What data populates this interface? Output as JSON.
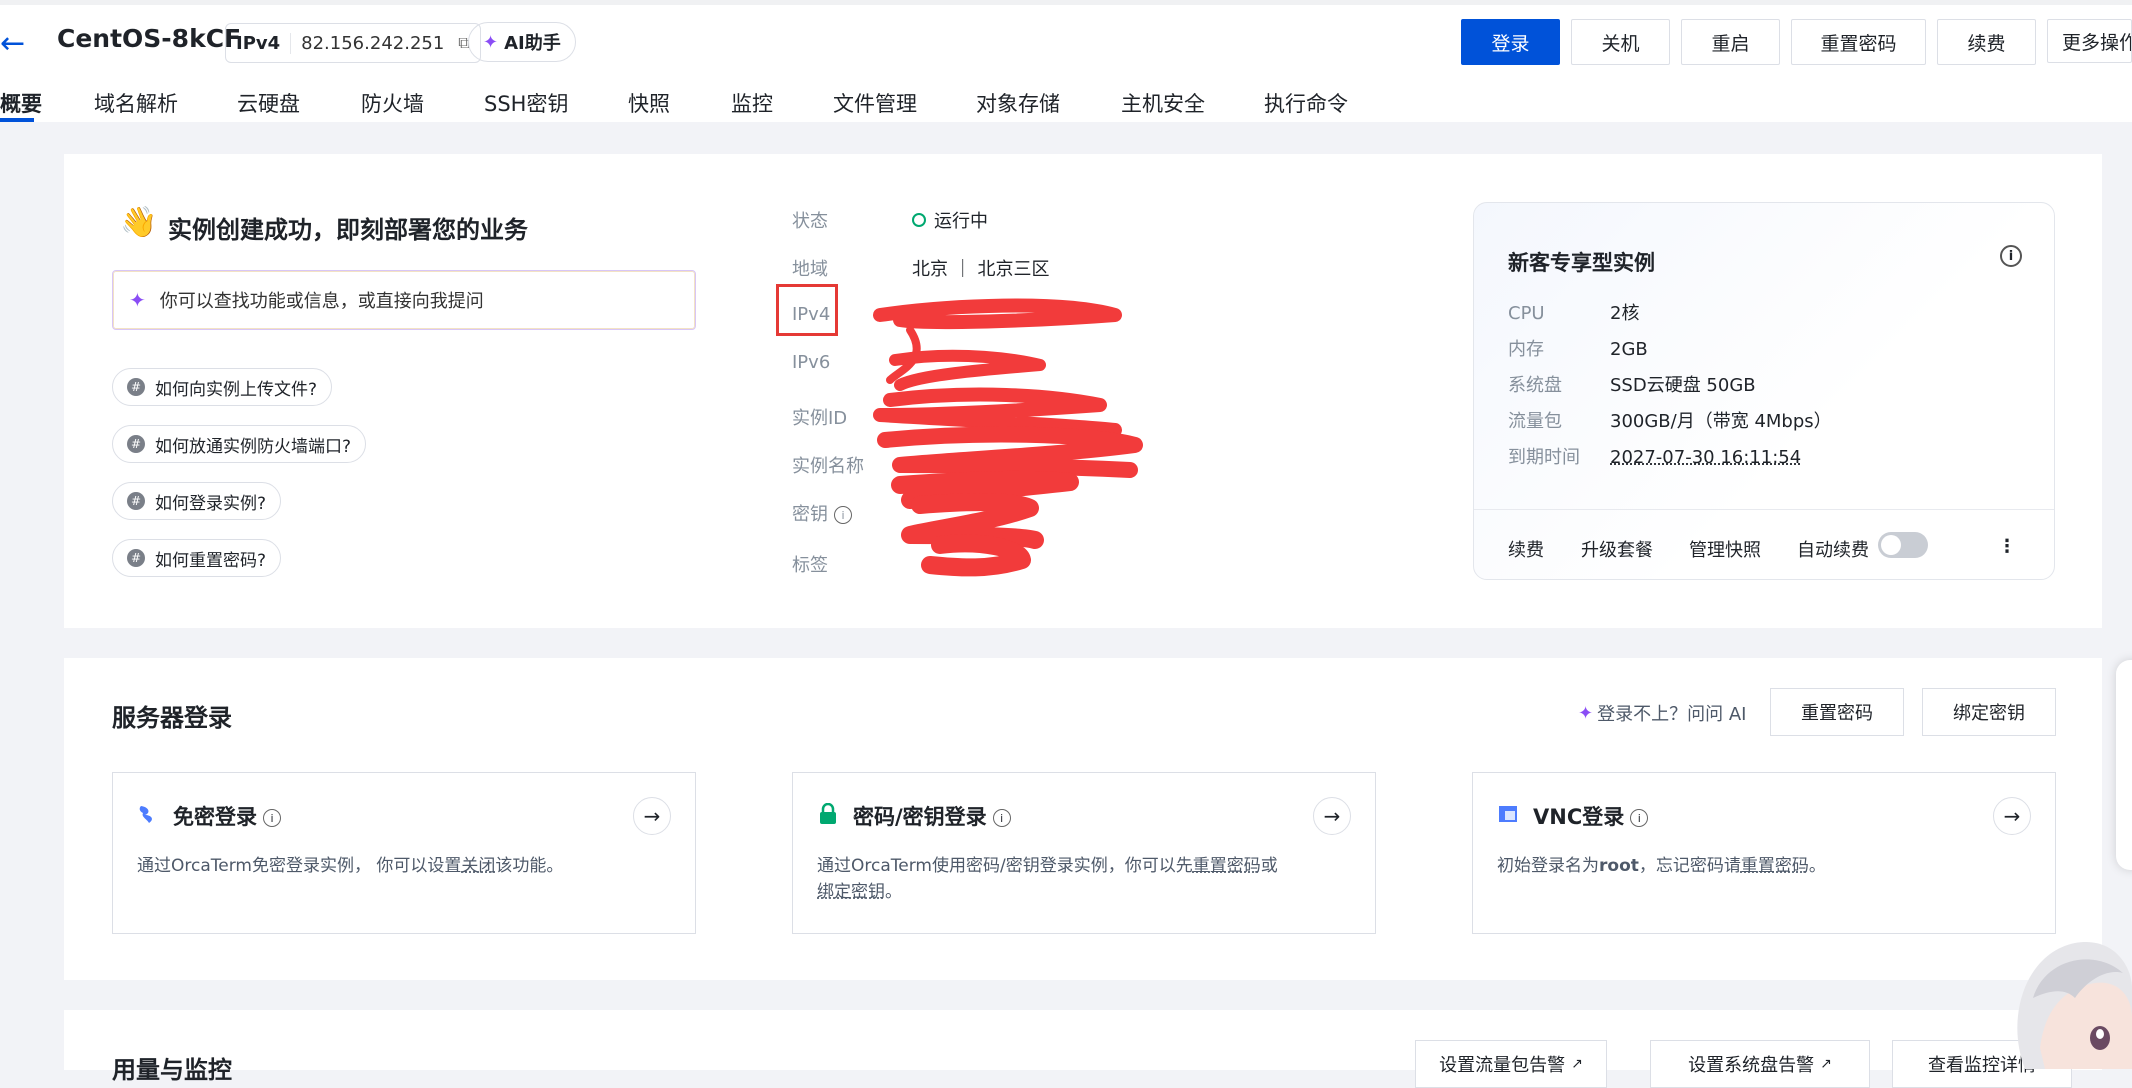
{
  "header": {
    "back_icon": "arrow-left-icon",
    "title": "CentOS-8kCF",
    "ip_label": "IPv4",
    "ip_value": "82.156.242.251",
    "ai_label": "AI助手",
    "buttons": {
      "login": "登录",
      "shutdown": "关机",
      "restart": "重启",
      "reset_password": "重置密码",
      "renew": "续费",
      "more": "更多操作"
    }
  },
  "tabs": [
    "概要",
    "域名解析",
    "云硬盘",
    "防火墙",
    "SSH密钥",
    "快照",
    "监控",
    "文件管理",
    "对象存储",
    "主机安全",
    "执行命令"
  ],
  "overview": {
    "welcome_title": "实例创建成功，即刻部署您的业务",
    "ask_placeholder": "你可以查找功能或信息，或直接向我提问",
    "questions": [
      "如何向实例上传文件?",
      "如何放通实例防火墙端口?",
      "如何登录实例?",
      "如何重置密码?"
    ],
    "info": {
      "status_label": "状态",
      "status_value": "运行中",
      "region_label": "地域",
      "region_value": "北京 ｜ 北京三区",
      "ipv4_label": "IPv4",
      "ipv6_label": "IPv6",
      "instance_id_label": "实例ID",
      "instance_name_label": "实例名称",
      "key_label": "密钥",
      "tag_label": "标签"
    },
    "spec": {
      "title": "新客专享型实例",
      "rows": [
        {
          "k": "CPU",
          "v": "2核"
        },
        {
          "k": "内存",
          "v": "2GB"
        },
        {
          "k": "系统盘",
          "v": "SSD云硬盘 50GB"
        },
        {
          "k": "流量包",
          "v": "300GB/月（带宽 4Mbps）"
        },
        {
          "k": "到期时间",
          "v": "2027-07-30 16:11:54"
        }
      ],
      "footer": {
        "renew": "续费",
        "upgrade": "升级套餐",
        "snapshot": "管理快照",
        "auto_renew": "自动续费",
        "auto_renew_on": false
      }
    }
  },
  "login_section": {
    "title": "服务器登录",
    "ask_ai": "登录不上？问问 AI",
    "reset_password": "重置密码",
    "bind_key": "绑定密钥",
    "cards": [
      {
        "title": "免密登录",
        "desc_a": "通过OrcaTerm免密登录实例，  你可以设置",
        "link_a": "关闭",
        "desc_b": "该功能。"
      },
      {
        "title": "密码/密钥登录",
        "desc_a": "通过OrcaTerm使用密码/密钥登录实例，你可以先",
        "link_a": "重置密码",
        "desc_b": "或",
        "link_b": "绑定密钥",
        "desc_c": "。"
      },
      {
        "title": "VNC登录",
        "desc_a": "初始登录名为",
        "bold": "root",
        "desc_b": "，忘记密码请",
        "link_a": "重置密码",
        "desc_c": "。"
      }
    ]
  },
  "usage_section": {
    "title": "用量与监控",
    "buttons": [
      "设置流量包告警",
      "设置系统盘告警",
      "查看监控详情"
    ]
  }
}
